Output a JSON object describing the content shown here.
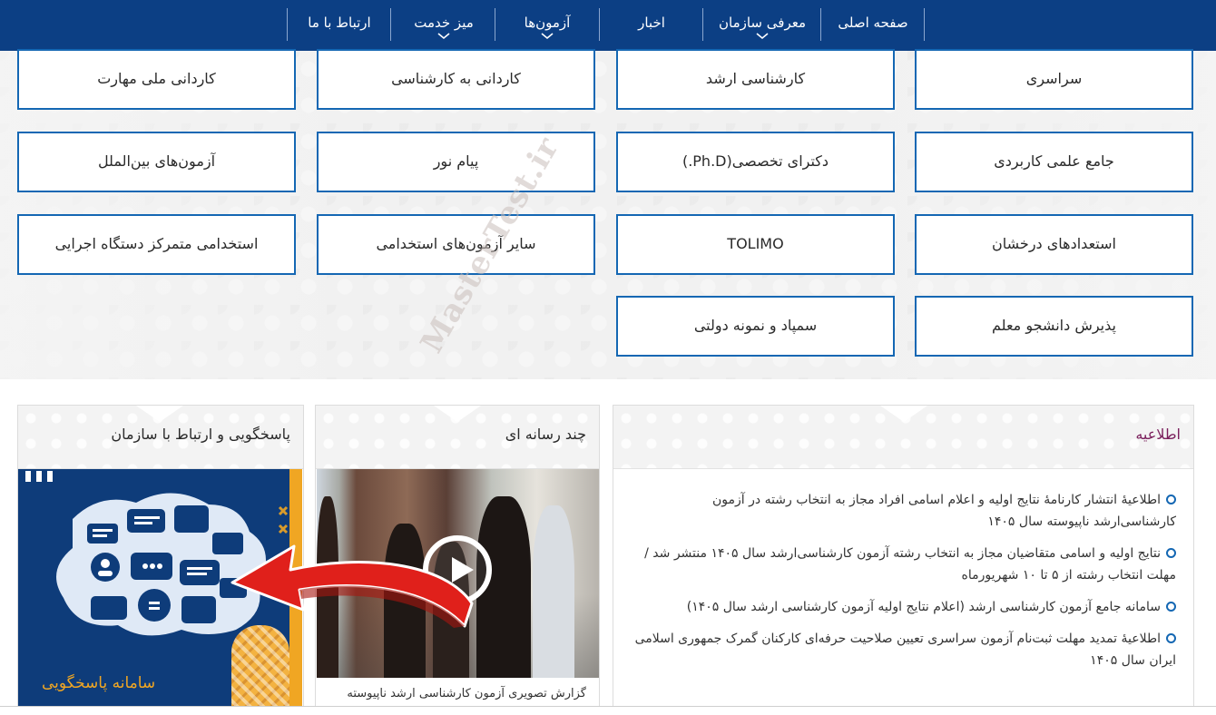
{
  "nav": {
    "home": "صفحه اصلی",
    "about": "معرفی سازمان",
    "news": "اخبار",
    "exams": "آزمون‌ها",
    "service_desk": "میز خدمت",
    "contact": "ارتباط با ما"
  },
  "categories": {
    "sarasari": "سراسری",
    "karshenasi_arshad": "کارشناسی ارشد",
    "kardani_be_karshenasi": "کاردانی به کارشناسی",
    "kardani_melli": "کاردانی ملی مهارت",
    "jame_elmi": "جامع علمی کاربردی",
    "doctora": "دکترای تخصصی(Ph.D.)",
    "payam_noor": "پیام نور",
    "international": "آزمون‌های بین‌الملل",
    "talented": "استعدادهای درخشان",
    "tolimo": "TOLIMO",
    "other_employment": "سایر آزمون‌های استخدامی",
    "central_employment": "استخدامی متمرکز دستگاه اجرایی",
    "teacher": "پذیرش دانشجو معلم",
    "sampad": "سمپاد و نمونه دولتی"
  },
  "watermark": "MasterTest.ir",
  "announcements": {
    "title": "اطلاعیه",
    "items": [
      "اطلاعیهٔ انتشار کارنامهٔ نتایج اولیه و اعلام اسامی افراد مجاز به انتخاب رشته در آزمون کارشناسی‌ارشد ناپیوسته سال ۱۴۰۵",
      "نتایج اولیه و اسامی متقاضیان مجاز به انتخاب رشته آزمون کارشناسی‌ارشد سال ۱۴۰۵ منتشر شد /مهلت انتخاب رشته از ۵ تا ۱۰ شهریورماه",
      "سامانه جامع آزمون کارشناسی ارشد (اعلام نتایج اولیه آزمون کارشناسی ارشد سال ۱۴۰۵)",
      "اطلاعیهٔ تمدید مهلت ثبت‌نام آزمون سراسری تعیین صلاحیت حرفه‌ای کارکنان گمرک جمهوری اسلامی ایران سال ۱۴۰۵"
    ]
  },
  "media": {
    "title": "چند رسانه ای",
    "caption": "گزارش تصویری آزمون کارشناسی ارشد ناپیوسته"
  },
  "support": {
    "title": "پاسخگویی و ارتباط با سازمان",
    "image_label": "سامانه پاسخگویی"
  },
  "colors": {
    "nav_bg": "#0c3f84",
    "button_border": "#1467b3",
    "accent_orange": "#f0a623",
    "arrow_red": "#e0201b"
  }
}
